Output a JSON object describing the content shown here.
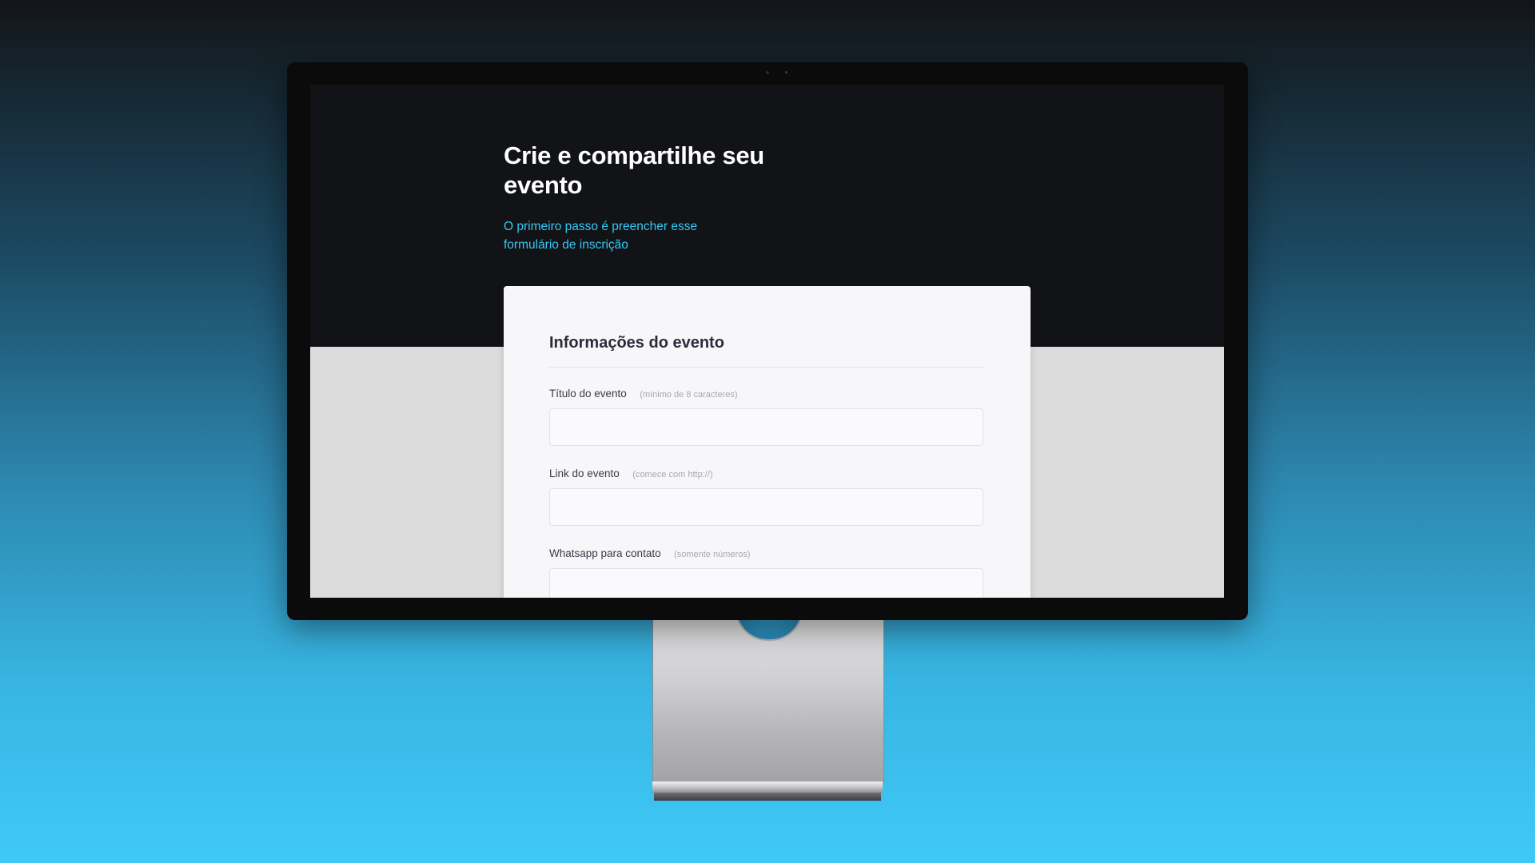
{
  "hero": {
    "title": "Crie e compartilhe seu evento",
    "subtitle": "O primeiro passo é preencher esse formulário de inscrição"
  },
  "form": {
    "title": "Informações do evento",
    "fields": [
      {
        "label": "Título do evento",
        "hint": "(mínimo de 8 caracteres)",
        "value": ""
      },
      {
        "label": "Link do evento",
        "hint": "(comece com http://)",
        "value": ""
      },
      {
        "label": "Whatsapp para contato",
        "hint": "(somente números)",
        "value": ""
      }
    ]
  },
  "colors": {
    "hero_background": "#121316",
    "accent": "#35c8f5",
    "card_background": "#f7f7f9",
    "page_background": "#dcdcdc"
  }
}
